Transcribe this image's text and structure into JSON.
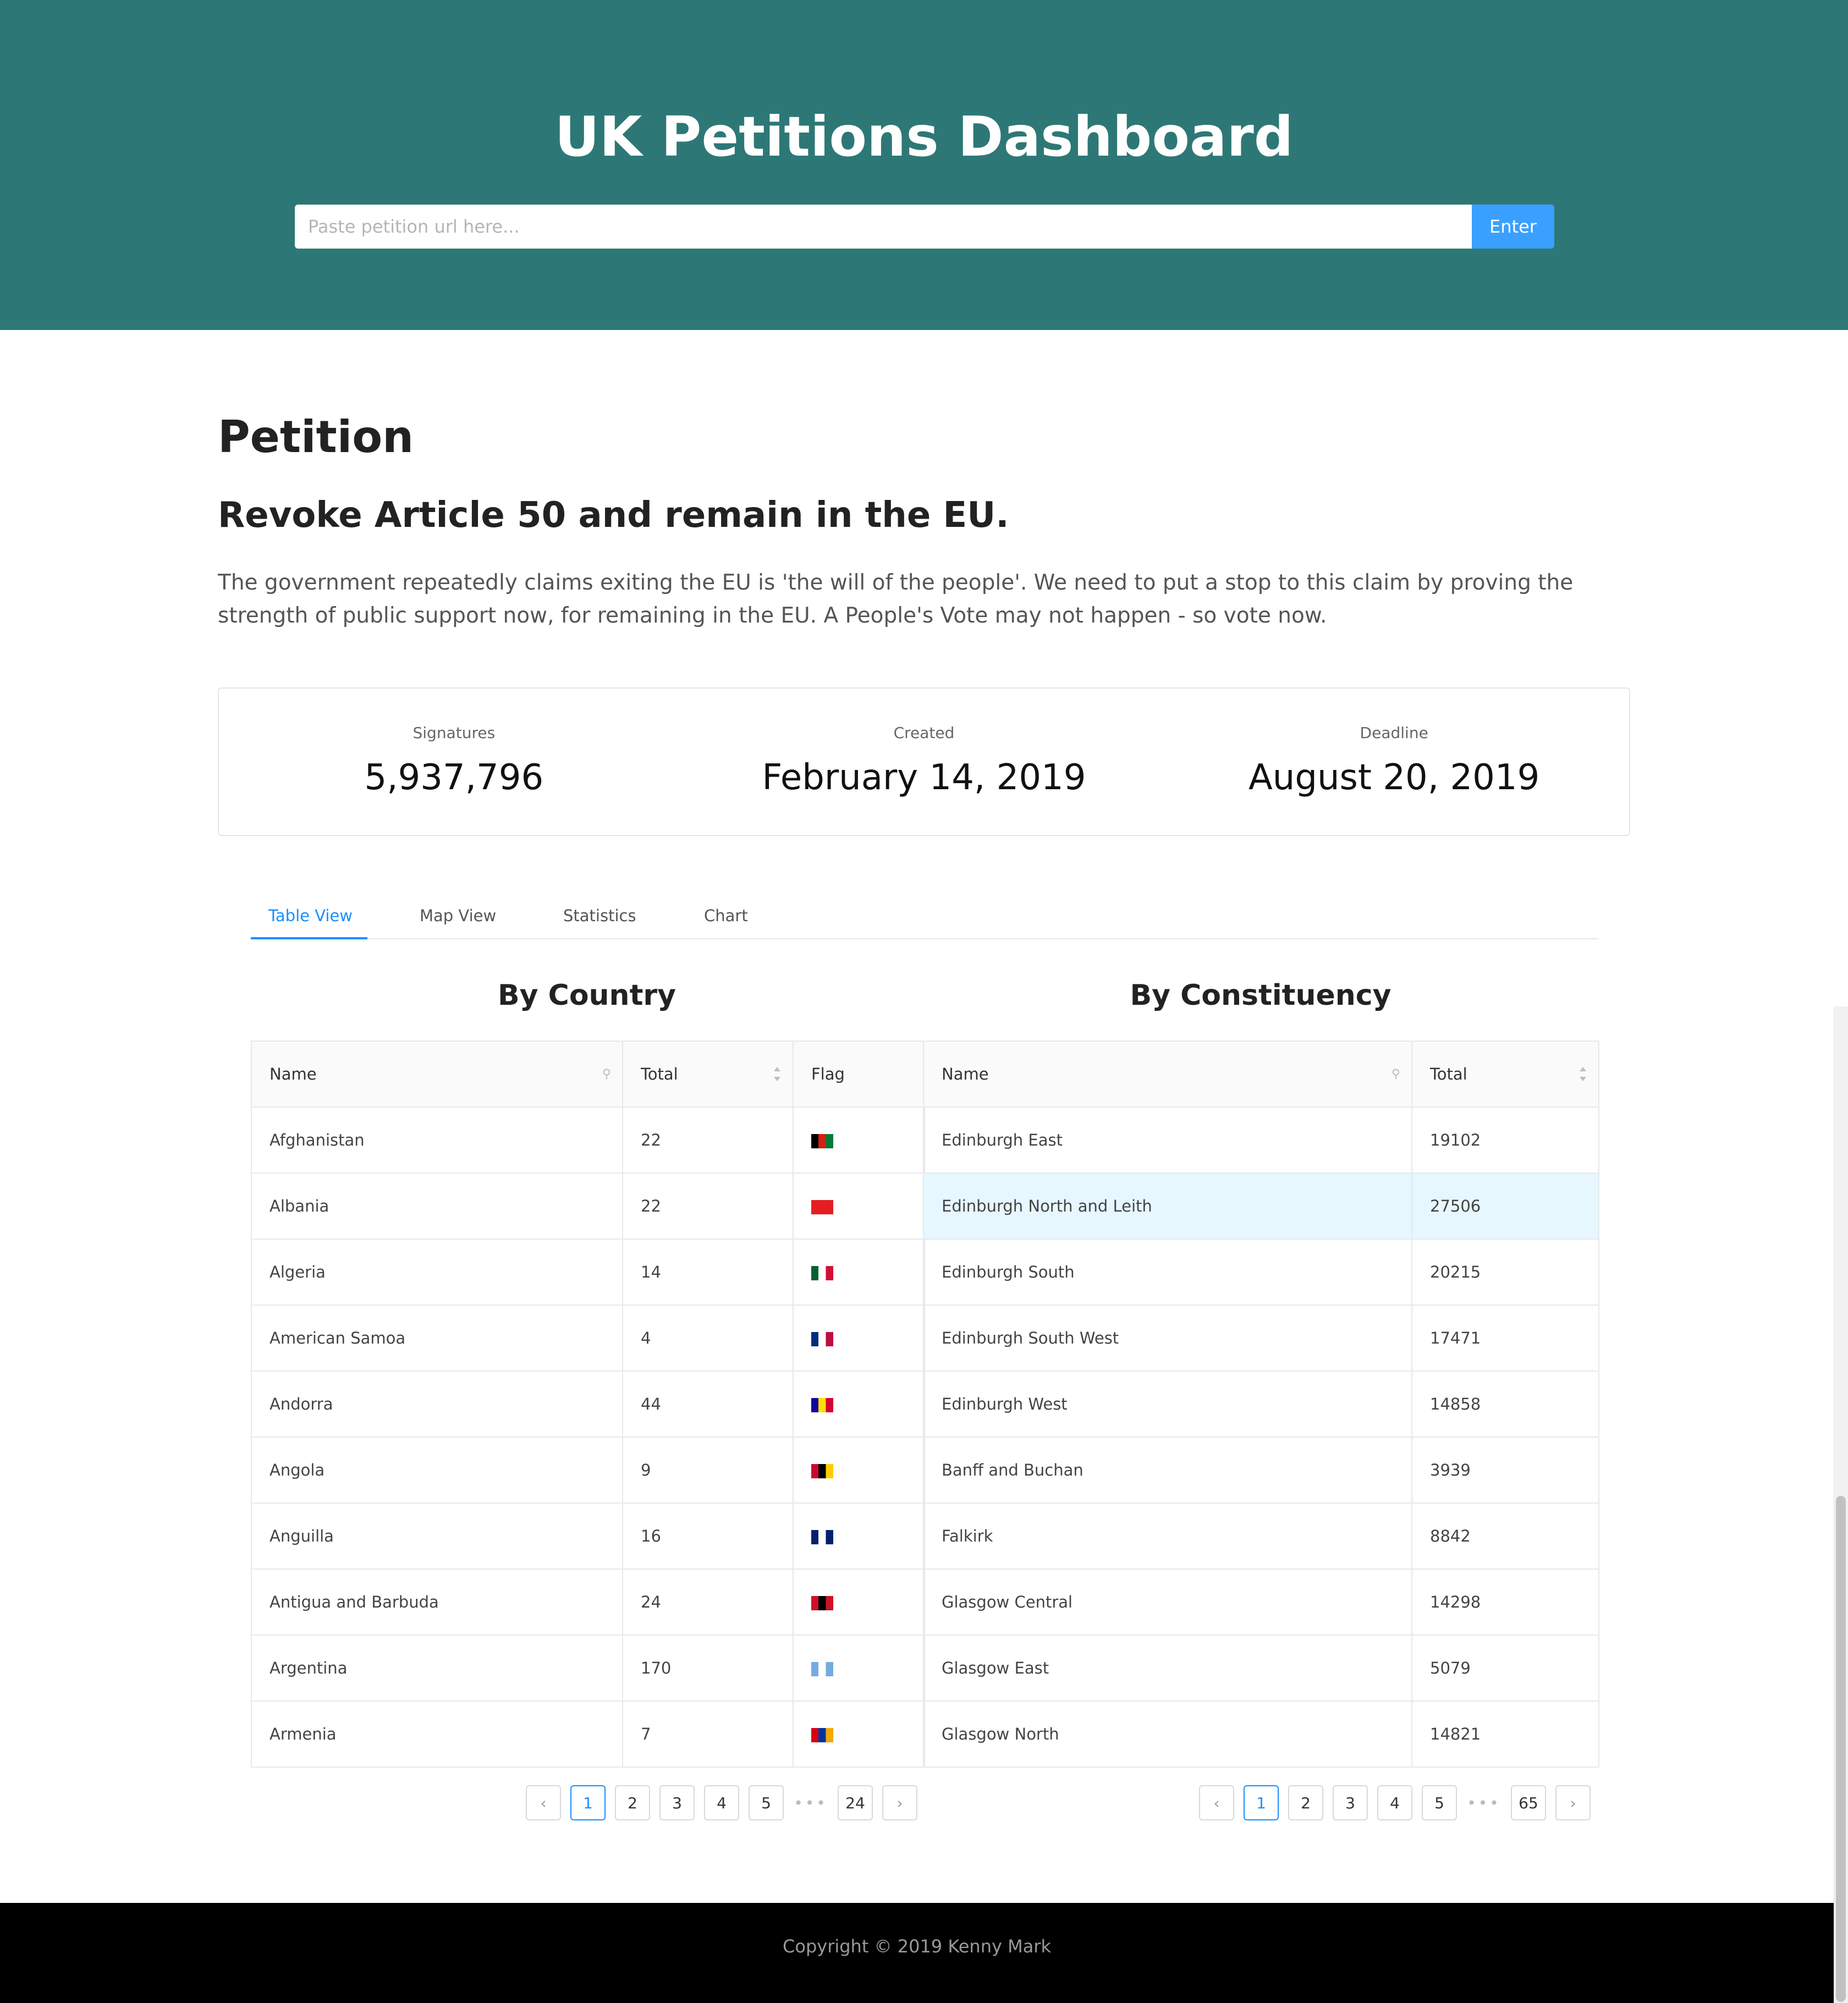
{
  "header": {
    "title": "UK Petitions Dashboard",
    "search_placeholder": "Paste petition url here...",
    "enter_label": "Enter"
  },
  "petition": {
    "heading": "Petition",
    "title": "Revoke Article 50 and remain in the EU.",
    "description": "The government repeatedly claims exiting the EU is 'the will of the people'. We need to put a stop to this claim by proving the strength of public support now, for remaining in the EU. A People's Vote may not happen - so vote now."
  },
  "stats": {
    "signatures_label": "Signatures",
    "signatures_value": "5,937,796",
    "created_label": "Created",
    "created_value": "February 14, 2019",
    "deadline_label": "Deadline",
    "deadline_value": "August 20, 2019"
  },
  "tabs": [
    {
      "label": "Table View",
      "active": true
    },
    {
      "label": "Map View",
      "active": false
    },
    {
      "label": "Statistics",
      "active": false
    },
    {
      "label": "Chart",
      "active": false
    }
  ],
  "country_table": {
    "title": "By Country",
    "headers": {
      "name": "Name",
      "total": "Total",
      "flag": "Flag"
    },
    "rows": [
      {
        "name": "Afghanistan",
        "total": "22",
        "flag": "flag-afghanistan-icon",
        "colors": [
          "#000000",
          "#d32011",
          "#007a36"
        ]
      },
      {
        "name": "Albania",
        "total": "22",
        "flag": "flag-albania-icon",
        "colors": [
          "#e41e20",
          "#e41e20",
          "#e41e20"
        ]
      },
      {
        "name": "Algeria",
        "total": "14",
        "flag": "flag-algeria-icon",
        "colors": [
          "#006233",
          "#ffffff",
          "#d21034"
        ]
      },
      {
        "name": "American Samoa",
        "total": "4",
        "flag": "flag-american-samoa-icon",
        "colors": [
          "#002b7f",
          "#ffffff",
          "#bf0d3e"
        ]
      },
      {
        "name": "Andorra",
        "total": "44",
        "flag": "flag-andorra-icon",
        "colors": [
          "#10069f",
          "#fedf00",
          "#d50032"
        ]
      },
      {
        "name": "Angola",
        "total": "9",
        "flag": "flag-angola-icon",
        "colors": [
          "#cc092f",
          "#000000",
          "#ffcb00"
        ]
      },
      {
        "name": "Anguilla",
        "total": "16",
        "flag": "flag-anguilla-icon",
        "colors": [
          "#012169",
          "#ffffff",
          "#012169"
        ]
      },
      {
        "name": "Antigua and Barbuda",
        "total": "24",
        "flag": "flag-antigua-and-barbuda-icon",
        "colors": [
          "#ce1126",
          "#000000",
          "#ce1126"
        ]
      },
      {
        "name": "Argentina",
        "total": "170",
        "flag": "flag-argentina-icon",
        "colors": [
          "#74acdf",
          "#ffffff",
          "#74acdf"
        ]
      },
      {
        "name": "Armenia",
        "total": "7",
        "flag": "flag-armenia-icon",
        "colors": [
          "#d90012",
          "#0033a0",
          "#f2a800"
        ]
      }
    ],
    "pagination": [
      "1",
      "2",
      "3",
      "4",
      "5",
      "•••",
      "24"
    ]
  },
  "constituency_table": {
    "title": "By Constituency",
    "headers": {
      "name": "Name",
      "total": "Total"
    },
    "rows": [
      {
        "name": "Edinburgh East",
        "total": "19102"
      },
      {
        "name": "Edinburgh North and Leith",
        "total": "27506",
        "highlighted": true
      },
      {
        "name": "Edinburgh South",
        "total": "20215"
      },
      {
        "name": "Edinburgh South West",
        "total": "17471"
      },
      {
        "name": "Edinburgh West",
        "total": "14858"
      },
      {
        "name": "Banff and Buchan",
        "total": "3939"
      },
      {
        "name": "Falkirk",
        "total": "8842"
      },
      {
        "name": "Glasgow Central",
        "total": "14298"
      },
      {
        "name": "Glasgow East",
        "total": "5079"
      },
      {
        "name": "Glasgow North",
        "total": "14821"
      }
    ],
    "pagination": [
      "1",
      "2",
      "3",
      "4",
      "5",
      "•••",
      "65"
    ]
  },
  "footer": {
    "copyright": "Copyright © 2019 Kenny Mark"
  }
}
